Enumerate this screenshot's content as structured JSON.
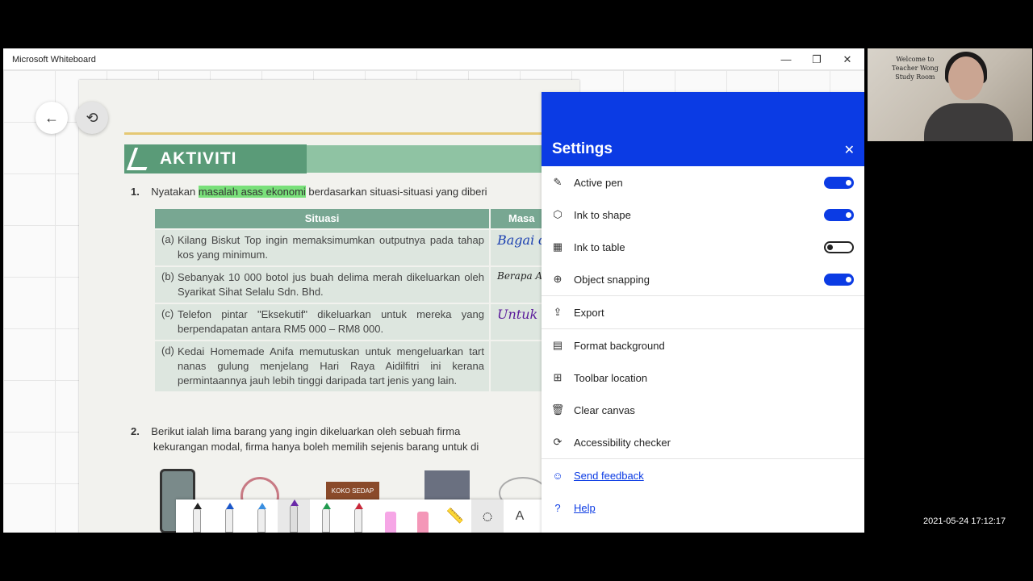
{
  "window": {
    "title": "Microsoft Whiteboard",
    "minimize": "—",
    "restore": "❐",
    "close": "✕"
  },
  "canvas": {
    "back_icon": "←",
    "undo_icon": "⟲"
  },
  "page": {
    "heading": "AKTIVITI",
    "q1": {
      "number": "1.",
      "text_before": "Nyatakan ",
      "highlight": "masalah asas ekonomi",
      "text_after": " berdasarkan situasi-situasi yang diberi"
    },
    "table": {
      "headers": [
        "Situasi",
        "Masa"
      ],
      "rows": [
        {
          "label": "(a)",
          "text": "Kilang Biskut Top ingin memaksimumkan outputnya pada tahap kos yang minimum.",
          "answer": "Bagai dike"
        },
        {
          "label": "(b)",
          "text": "Sebanyak 10 000 botol jus buah delima merah dikeluarkan oleh Syarikat Sihat Selalu Sdn. Bhd.",
          "answer": "Berapa Apa yan"
        },
        {
          "label": "(c)",
          "text": "Telefon pintar \"Eksekutif\" dikeluarkan untuk mereka yang berpendapatan antara RM5 000 – RM8 000.",
          "answer": "Untuk dike"
        },
        {
          "label": "(d)",
          "text": "Kedai Homemade Anifa memutuskan untuk mengeluarkan tart nanas gulung menjelang Hari Raya Aidilfitri ini kerana permintaannya jauh lebih tinggi daripada tart jenis yang lain.",
          "answer": ""
        }
      ]
    },
    "q2": {
      "number": "2.",
      "line1": "Berikut ialah lima barang yang ingin dikeluarkan oleh sebuah firma",
      "line2": "kekurangan modal, firma hanya boleh memilih sejenis barang untuk di"
    },
    "product_label": "KOKO SEDAP"
  },
  "toolbar": {
    "pens": [
      {
        "name": "pen-black",
        "color": "#222222"
      },
      {
        "name": "pen-blue",
        "color": "#1a56c9"
      },
      {
        "name": "pen-lightblue",
        "color": "#3a8fe0"
      },
      {
        "name": "pen-purple",
        "color": "#6a2aa8"
      },
      {
        "name": "pen-green",
        "color": "#1f9a4e"
      },
      {
        "name": "pen-red",
        "color": "#c8283a"
      },
      {
        "name": "highlighter-pink",
        "color": "#f6a6e6"
      },
      {
        "name": "highlighter-rose",
        "color": "#f497b8"
      }
    ],
    "ruler_icon": "📏",
    "lasso_icon": "◌",
    "text_tool": "A"
  },
  "settings": {
    "title": "Settings",
    "close_icon": "✕",
    "items": [
      {
        "label": "Active pen",
        "icon": "✎",
        "toggle": true
      },
      {
        "label": "Ink to shape",
        "icon": "⬡",
        "toggle": true
      },
      {
        "label": "Ink to table",
        "icon": "▦",
        "toggle": false
      },
      {
        "label": "Object snapping",
        "icon": "⊕",
        "toggle": true
      }
    ],
    "actions": [
      {
        "label": "Export",
        "icon": "⇪"
      },
      {
        "label": "Format background",
        "icon": "▤"
      },
      {
        "label": "Toolbar location",
        "icon": "⊞"
      },
      {
        "label": "Clear canvas",
        "icon": "🗑"
      },
      {
        "label": "Accessibility checker",
        "icon": "⟳"
      }
    ],
    "links": [
      {
        "label": "Send feedback",
        "icon": "☺"
      },
      {
        "label": "Help",
        "icon": "?"
      }
    ]
  },
  "webcam": {
    "line1": "Welcome to",
    "line2": "Teacher Wong",
    "line3": "Study Room"
  },
  "timestamp": "2021-05-24  17:12:17",
  "colors": {
    "accent": "#0b3be4",
    "highlight_green": "#79e07a",
    "highlight_blue": "#a9d4f2",
    "highlight_yellow": "#f3ef5b",
    "highlight_pink": "#ee8de0"
  }
}
